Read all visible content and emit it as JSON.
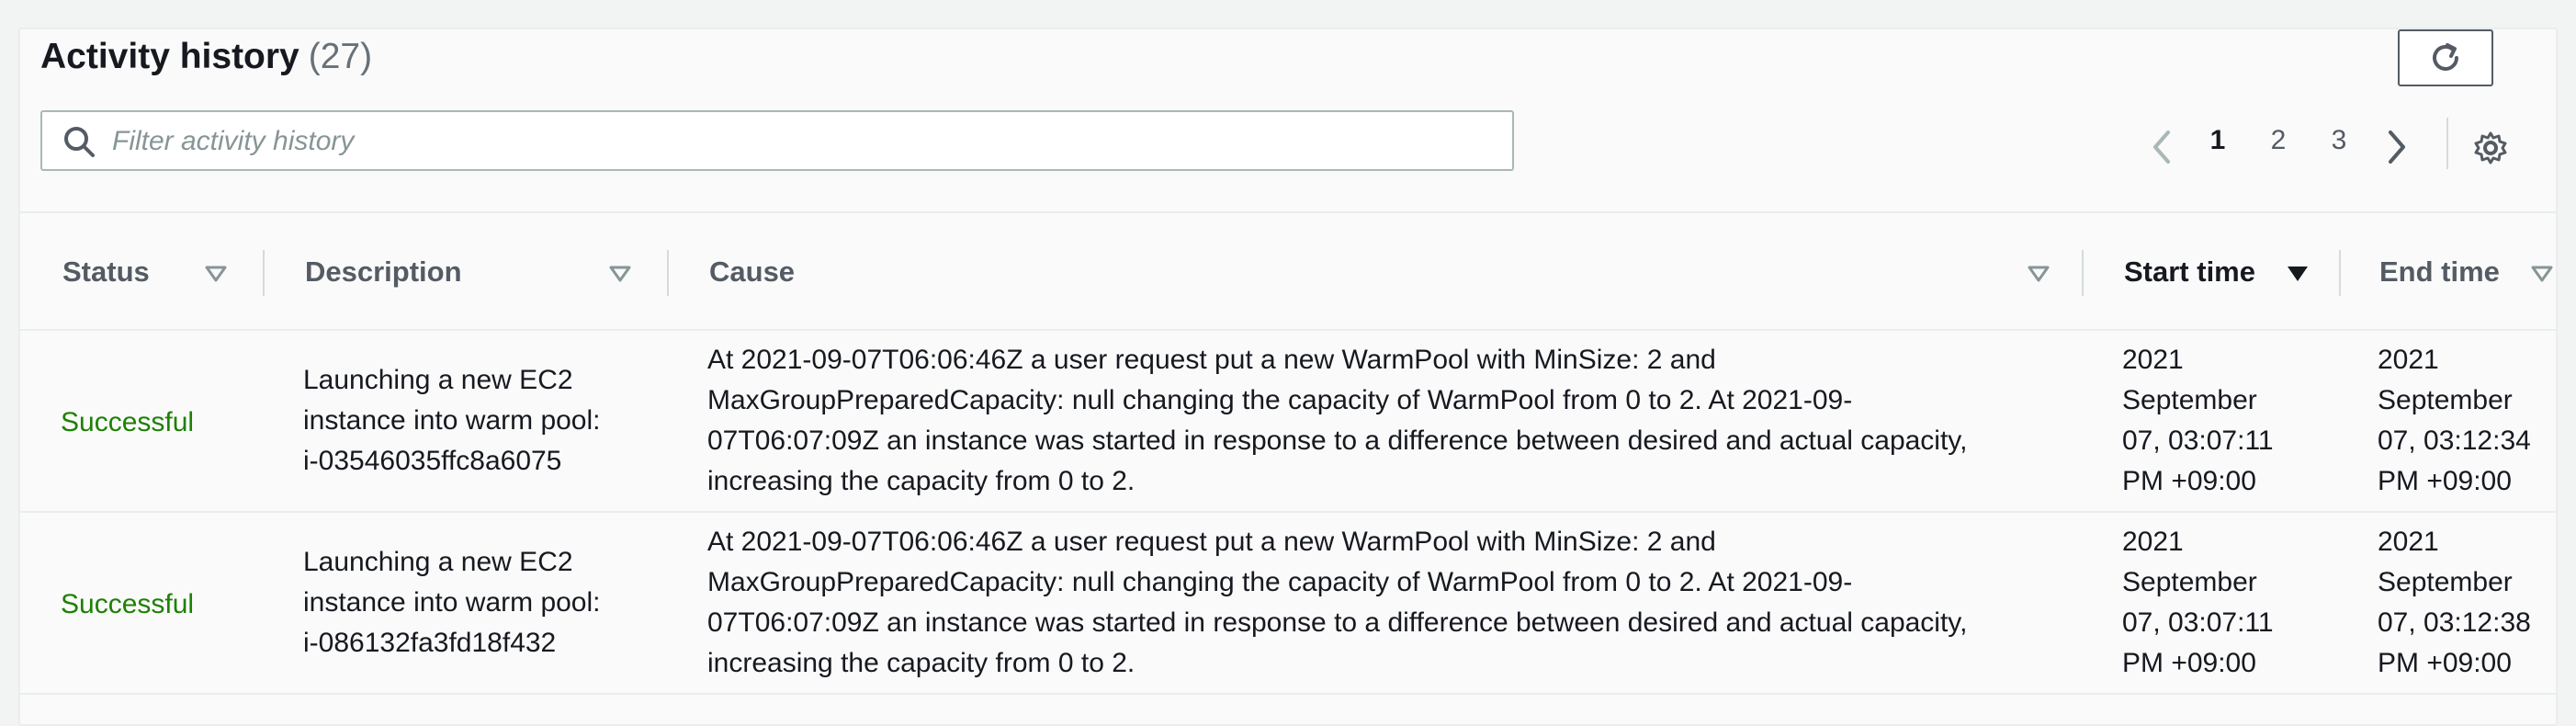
{
  "header": {
    "title": "Activity history",
    "count": "(27)"
  },
  "search": {
    "placeholder": "Filter activity history",
    "value": ""
  },
  "pagination": {
    "pages": [
      "1",
      "2",
      "3"
    ],
    "current": "1"
  },
  "table": {
    "columns": [
      "Status",
      "Description",
      "Cause",
      "Start time",
      "End time"
    ],
    "rows": [
      {
        "status": "Successful",
        "description": [
          "Launching a new EC2",
          "instance into warm pool:",
          "i-03546035ffc8a6075"
        ],
        "cause": [
          "At 2021-09-07T06:06:46Z a user request put a new WarmPool with MinSize: 2 and",
          "MaxGroupPreparedCapacity: null changing the capacity of WarmPool from 0 to 2. At 2021-09-",
          "07T06:07:09Z an instance was started in response to a difference between desired and actual capacity,",
          "increasing the capacity from 0 to 2."
        ],
        "start_time": [
          "2021",
          "September",
          "07, 03:07:11",
          "PM +09:00"
        ],
        "end_time": [
          "2021",
          "September",
          "07, 03:12:34",
          "PM +09:00"
        ]
      },
      {
        "status": "Successful",
        "description": [
          "Launching a new EC2",
          "instance into warm pool:",
          "i-086132fa3fd18f432"
        ],
        "cause": [
          "At 2021-09-07T06:06:46Z a user request put a new WarmPool with MinSize: 2 and",
          "MaxGroupPreparedCapacity: null changing the capacity of WarmPool from 0 to 2. At 2021-09-",
          "07T06:07:09Z an instance was started in response to a difference between desired and actual capacity,",
          "increasing the capacity from 0 to 2."
        ],
        "start_time": [
          "2021",
          "September",
          "07, 03:07:11",
          "PM +09:00"
        ],
        "end_time": [
          "2021",
          "September",
          "07, 03:12:38",
          "PM +09:00"
        ]
      }
    ]
  },
  "icons": {
    "refresh": "refresh-icon",
    "search": "search-icon",
    "prev": "chevron-left-icon",
    "next": "chevron-right-icon",
    "settings": "gear-icon",
    "sort": "caret-down-icon"
  },
  "colors": {
    "success": "#1d8102",
    "text": "#16191f",
    "muted": "#545b64"
  }
}
